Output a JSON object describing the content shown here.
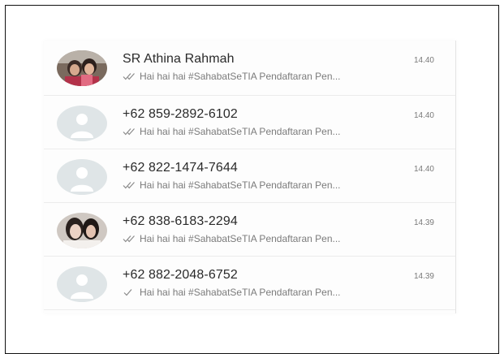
{
  "chats": [
    {
      "name": "SR Athina Rahmah",
      "time": "14.40",
      "preview": "Hai hai hai #SahabatSeTIA Pendaftaran Pen...",
      "ticks": "double",
      "avatar": "photo-couple"
    },
    {
      "name": "+62 859-2892-6102",
      "time": "14.40",
      "preview": "Hai hai hai #SahabatSeTIA Pendaftaran Pen...",
      "ticks": "double",
      "avatar": "default"
    },
    {
      "name": "+62 822-1474-7644",
      "time": "14.40",
      "preview": "Hai hai hai #SahabatSeTIA Pendaftaran Pen...",
      "ticks": "double",
      "avatar": "default"
    },
    {
      "name": "+62 838-6183-2294",
      "time": "14.39",
      "preview": "Hai hai hai #SahabatSeTIA Pendaftaran Pen...",
      "ticks": "double",
      "avatar": "photo-selfie"
    },
    {
      "name": "+62 882-2048-6752",
      "time": "14.39",
      "preview": "Hai hai hai #SahabatSeTIA Pendaftaran Pen...",
      "ticks": "single",
      "avatar": "default"
    }
  ],
  "colors": {
    "avatar_default_bg": "#dfe5e7",
    "avatar_default_fg": "#ffffff",
    "tick": "#8a8a8a"
  }
}
